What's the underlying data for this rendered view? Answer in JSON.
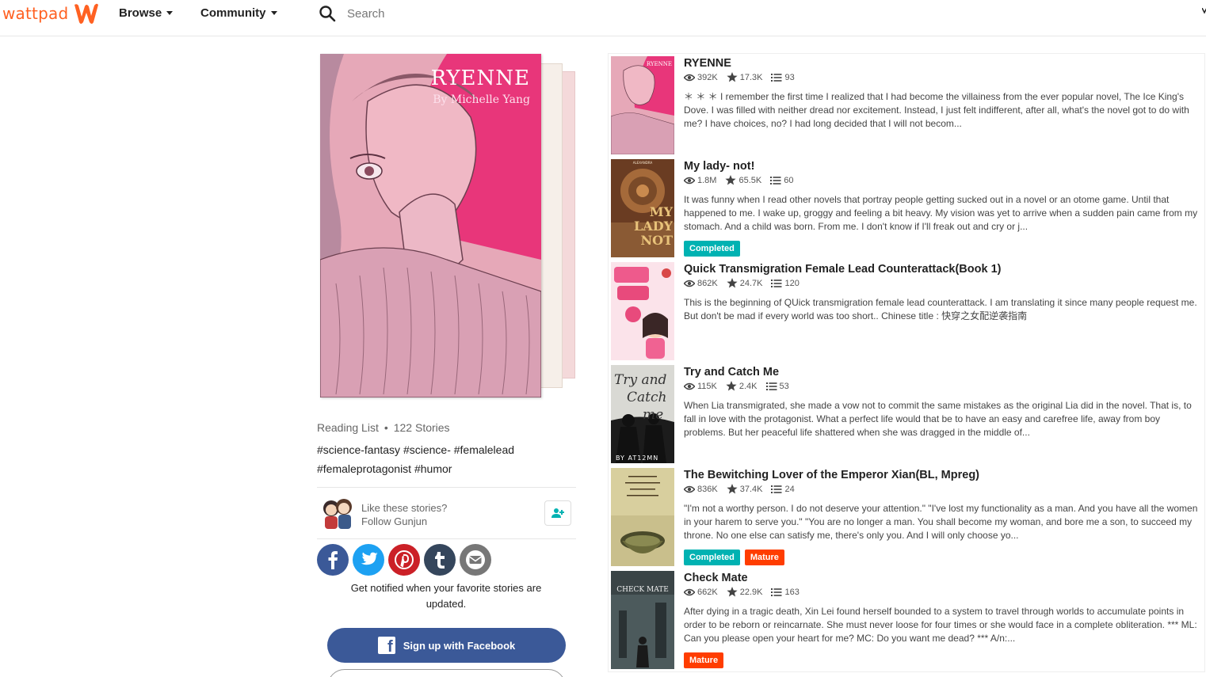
{
  "header": {
    "logo_text": "wattpad",
    "browse_label": "Browse",
    "community_label": "Community",
    "search_placeholder": "Search"
  },
  "reading_list": {
    "cover_title": "RYENNE",
    "cover_author": "By Michelle Yang",
    "type_label": "Reading List",
    "story_count": "122 Stories",
    "tags": "#science-fantasy #science- #femalelead #femaleprotagonist #humor",
    "follow_line1": "Like these stories?",
    "follow_line2": "Follow Gunjun",
    "notify_text": "Get notified when your favorite stories are updated.",
    "facebook_signup": "Sign up with Facebook"
  },
  "colors": {
    "brand": "#ff6122",
    "completed": "#00b2b2",
    "mature": "#ff3d00",
    "facebook": "#3b5998"
  },
  "socials": [
    "facebook",
    "twitter",
    "pinterest",
    "tumblr",
    "email"
  ],
  "stories": [
    {
      "title": "RYENNE",
      "reads": "392K",
      "votes": "17.3K",
      "parts": "93",
      "description": "＊ ＊ ＊ I remember the first time I realized that I had become the villainess from the ever popular novel, The Ice King's Dove. I was filled with neither dread nor excitement. Instead, I just felt indifferent, after all, what's the novel got to do with me? I have choices, no? I had long decided that I will not becom...",
      "completed": false,
      "mature": false
    },
    {
      "title": "My lady- not!",
      "reads": "1.8M",
      "votes": "65.5K",
      "parts": "60",
      "description": "It was funny when I read other novels that portray people getting sucked out in a novel or an otome game. Until that happened to me. I wake up, groggy and feeling a bit heavy. My vision was yet to arrive when a sudden pain came from my stomach. And a child was born. From me. I don't know if I'll freak out and cry or j...",
      "completed": true,
      "mature": false
    },
    {
      "title": "Quick Transmigration Female Lead Counterattack(Book 1)",
      "reads": "862K",
      "votes": "24.7K",
      "parts": "120",
      "description": "This is the beginning of QUick transmigration female lead counterattack. I am translating it since many people request me. But don't be mad if every world was too short.. Chinese title : 快穿之女配逆袭指南",
      "completed": false,
      "mature": false
    },
    {
      "title": "Try and Catch Me",
      "reads": "115K",
      "votes": "2.4K",
      "parts": "53",
      "description": "When Lia transmigrated, she made a vow not to commit the same mistakes as the original Lia did in the novel. That is, to fall in love with the protagonist. What a perfect life would that be to have an easy and carefree life, away from boy problems. But her peaceful life shattered when she was dragged in the middle of...",
      "completed": false,
      "mature": false
    },
    {
      "title": "The Bewitching Lover of the Emperor Xian(BL, Mpreg)",
      "reads": "836K",
      "votes": "37.4K",
      "parts": "24",
      "description": "\"I'm not a worthy person. I do not deserve your attention.\" \"I've lost my functionality as a man. And you have all the women in your harem to serve you.\" \"You are no longer a man. You shall become my woman, and bore me a son, to succeed my throne. No one else can satisfy me, there's only you. And I will only choose yo...",
      "completed": true,
      "mature": true
    },
    {
      "title": "Check Mate",
      "reads": "662K",
      "votes": "22.9K",
      "parts": "163",
      "description": "After dying in a tragic death, Xin Lei found herself bounded to a system to travel through worlds to accumulate points in order to be reborn or reincarnate. She must never loose for four times or she would face in a complete obliteration. *** ML: Can you please open your heart for me? MC: Do you want me dead? *** A/n:...",
      "completed": false,
      "mature": true
    }
  ],
  "badges": {
    "completed_label": "Completed",
    "mature_label": "Mature"
  },
  "thumb_texts": {
    "my_lady_top": "ALEXANDRA",
    "my_lady_line1": "MY",
    "my_lady_line2": "LADY",
    "my_lady_line3": "NOT",
    "try_line1": "Try and",
    "try_line2": "Catch",
    "try_line3": "me",
    "try_author": "BY AT12MN",
    "check_mate": "CHECK MATE"
  }
}
